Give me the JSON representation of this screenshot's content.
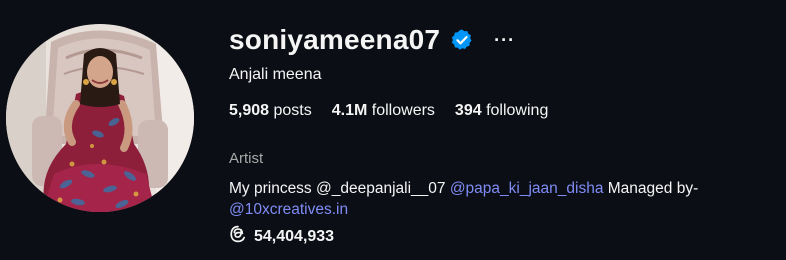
{
  "profile": {
    "username": "soniyameena07",
    "verified": true,
    "more_label": "···",
    "full_name": "Anjali meena",
    "stats": {
      "posts_count": "5,908",
      "posts_label": "posts",
      "followers_count": "4.1M",
      "followers_label": "followers",
      "following_count": "394",
      "following_label": "following"
    },
    "category": "Artist",
    "bio": {
      "prefix": "My princess @_deepanjali__07 ",
      "mention_1": "@papa_ki_jaan_disha",
      "middle": " Managed by-",
      "mention_2": "@10xcreatives.in"
    },
    "threads_count": "54,404,933"
  },
  "colors": {
    "background": "#0b0e14",
    "text": "#f5f5f5",
    "muted": "#a8a8a8",
    "link": "#7f8cf5",
    "verified_badge": "#0095f6"
  },
  "icons": {
    "verified": "verified-badge-icon",
    "more": "more-options-icon",
    "threads": "threads-icon"
  }
}
